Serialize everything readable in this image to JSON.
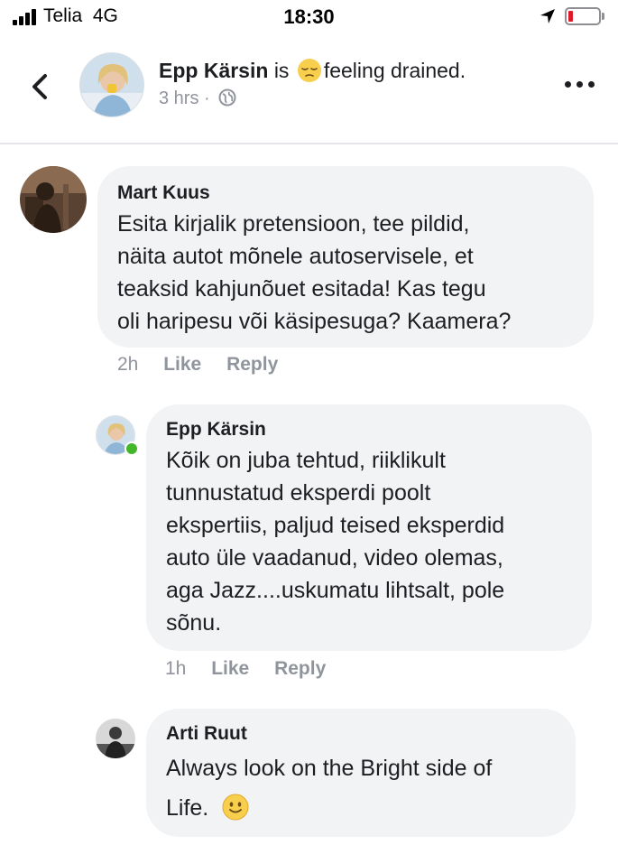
{
  "status_bar": {
    "carrier": "Telia",
    "network": "4G",
    "time": "18:30",
    "battery_level": 0.15,
    "icons": [
      "signal-icon",
      "location-arrow-icon",
      "battery-icon"
    ]
  },
  "header": {
    "author": "Epp Kärsin",
    "connector": "is",
    "feeling_emoji": "relieved-face-emoji",
    "feeling": "feeling drained.",
    "time": "3 hrs",
    "separator": "·",
    "audience_icon": "globe-icon",
    "icons": [
      "back-chevron-icon",
      "more-options-icon"
    ]
  },
  "comments": [
    {
      "author": "Mart Kuus",
      "lines": [
        "Esita kirjalik pretensioon, tee pildid,",
        "näita autot mõnele autoservisele, et",
        "teaksid kahjunõuet esitada! Kas tegu",
        "oli haripesu või käsipesuga? Kaamera?"
      ],
      "time": "2h",
      "like": "Like",
      "reply": "Reply"
    },
    {
      "author": "Epp Kärsin",
      "online": true,
      "lines": [
        "Kõik on juba tehtud, riiklikult",
        "tunnustatud eksperdi poolt",
        "ekspertiis, paljud teised eksperdid",
        "auto üle vaadanud, video olemas,",
        "aga Jazz....uskumatu lihtsalt, pole",
        "sõnu."
      ],
      "time": "1h",
      "like": "Like",
      "reply": "Reply"
    },
    {
      "author": "Arti Ruut",
      "lines": [
        "Always look on the Bright side of",
        "Life."
      ],
      "trailing_emoji": "slightly-smiling-face-emoji"
    }
  ],
  "colors": {
    "bubble": "#f2f3f5",
    "meta_text": "#90949c",
    "online_dot": "#42b72a",
    "battery_low": "#e0182b"
  }
}
